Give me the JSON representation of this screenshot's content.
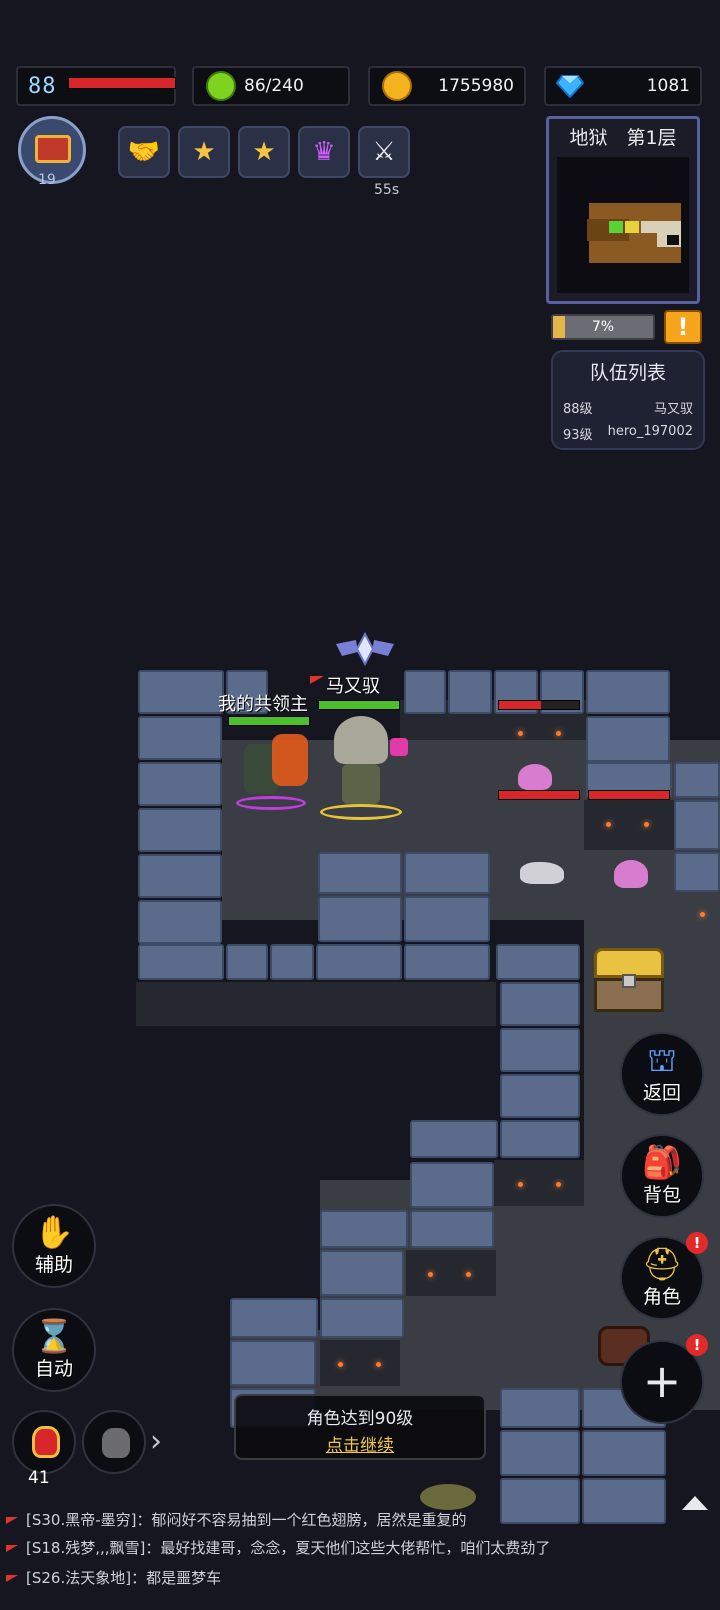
{
  "top_bar": {
    "hp_level": "88",
    "stamina": "86/240",
    "gold": "1755980",
    "diamonds": "1081"
  },
  "chest_level": "19",
  "buff_timer": "55s",
  "minimap": {
    "title": "地狱　第1层"
  },
  "progress": {
    "value_percent": 7,
    "label": "7%"
  },
  "alert_icon": "!",
  "team": {
    "title": "队伍列表",
    "members": [
      {
        "level": "88级",
        "name": "马又驭"
      },
      {
        "level": "93级",
        "name": "hero_197002"
      }
    ]
  },
  "characters": {
    "pet_name": "我的共领主",
    "hero_name": "马又驭"
  },
  "right_buttons": {
    "back": "返回",
    "bag": "背包",
    "role": "角色",
    "plus": "+"
  },
  "left_buttons": {
    "assist": "辅助",
    "auto": "自动",
    "potion_count": "41"
  },
  "toast": {
    "message": "角色达到90级",
    "action": "点击继续"
  },
  "chat": [
    {
      "text": "[S30.黑帝-墨穷]：郁闷好不容易抽到一个红色翅膀，居然是重复的"
    },
    {
      "text": "[S18.残梦,,,飘雪]：最好找建哥，念念，夏天他们这些大佬帮忙，咱们太费劲了"
    },
    {
      "text": "[S26.法天象地]：都是噩梦车"
    }
  ],
  "colors": {
    "hp_red": "#d8262b",
    "accent_gold": "#e4b64a",
    "minimap_border": "#5a5f9e"
  }
}
